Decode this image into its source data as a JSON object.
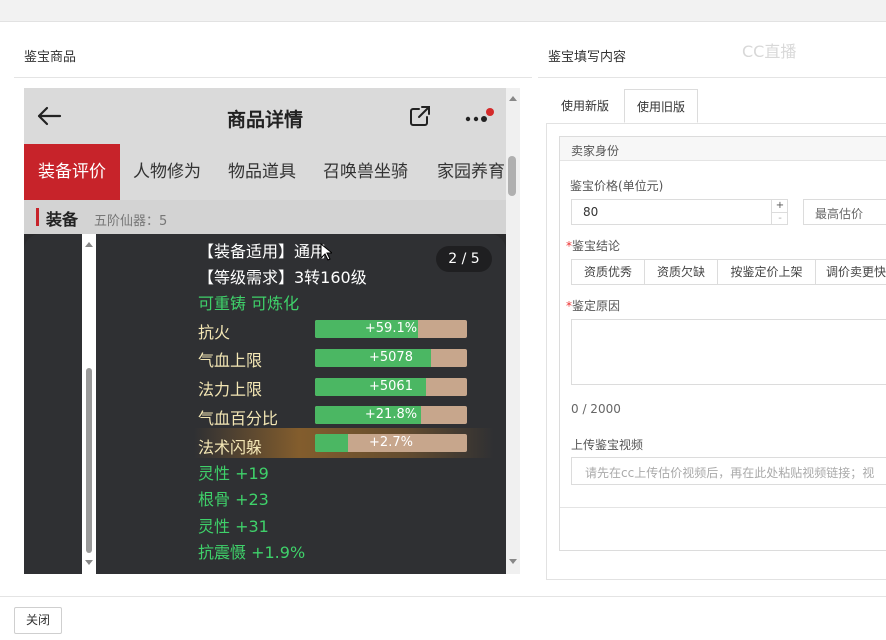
{
  "left_panel": {
    "title": "鉴宝商品"
  },
  "right_panel": {
    "title": "鉴宝填写内容",
    "watermark": "CC直播"
  },
  "phone": {
    "header_title": "商品详情",
    "tabs": [
      "装备评价",
      "人物修为",
      "物品道具",
      "召唤兽坐骑",
      "家园养育"
    ],
    "active_tab": "装备评价",
    "section_title": "装备",
    "section_sub": "五阶仙器：5",
    "pager": "2 / 5",
    "equip_lines": [
      "【装备适用】通用",
      "【等级需求】3转160级"
    ],
    "recast_line": "可重铸 可炼化",
    "stats": [
      {
        "label": "抗火",
        "value": "+59.1%",
        "fill": 0.68
      },
      {
        "label": "气血上限",
        "value": "+5078",
        "fill": 0.76
      },
      {
        "label": "法力上限",
        "value": "+5061",
        "fill": 0.73
      },
      {
        "label": "气血百分比",
        "value": "+21.8%",
        "fill": 0.7
      },
      {
        "label": "法术闪躲",
        "value": "+2.7%",
        "fill": 0.22
      }
    ],
    "extra_lines": [
      "灵性 +19",
      "根骨 +23",
      "灵性 +31",
      "抗震慑 +1.9%"
    ]
  },
  "form": {
    "tab_new": "使用新版",
    "tab_old": "使用旧版",
    "seller_identity": "卖家身份",
    "price_label": "鉴宝价格(单位元)",
    "price_value": "80",
    "max_estimate_placeholder": "最高估价",
    "conclusion_label": "鉴宝结论",
    "conclusion_options": [
      "资质优秀",
      "资质欠缺",
      "按鉴定价上架",
      "调价卖更快"
    ],
    "reason_label": "鉴定原因",
    "char_count": "0 / 2000",
    "video_label": "上传鉴宝视频",
    "video_placeholder": "请先在cc上传估价视频后，再在此处粘贴视频链接；视"
  },
  "footer": {
    "close_label": "关闭"
  }
}
